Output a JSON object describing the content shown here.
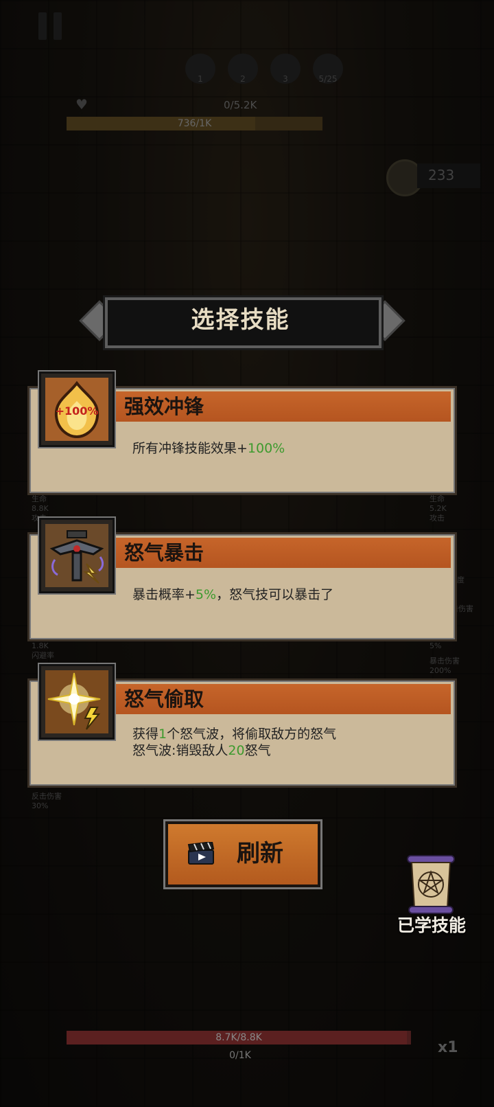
{
  "hud": {
    "stage_numbers": [
      "1",
      "2",
      "3",
      "5/25"
    ],
    "enemy_hp": "0/5.2K",
    "enemy_rage": "736/1K",
    "enemy_rage_fill": 0.736,
    "coins": "233",
    "left_stats": [
      "生命",
      "8.8K",
      "攻击",
      "1.8K",
      "闪避率",
      "反击伤害",
      "30%"
    ],
    "right_stats": [
      "生命",
      "5.2K",
      "攻击",
      "度",
      "暴击伤害",
      "5%",
      "暴击伤害",
      "200%"
    ]
  },
  "dialog": {
    "title": "选择技能"
  },
  "skills": [
    {
      "name": "强效冲锋",
      "icon": "flame-icon",
      "icon_text": "+100%",
      "desc_lines": [
        {
          "prefix": "所有冲锋技能效果+",
          "value": "100%",
          "suffix": ""
        }
      ]
    },
    {
      "name": "怒气暴击",
      "icon": "hammer-crit-icon",
      "desc_lines": [
        {
          "prefix": "暴击概率+",
          "value": "5%",
          "suffix": "，怒气技可以暴击了"
        }
      ]
    },
    {
      "name": "怒气偷取",
      "icon": "star-lightning-icon",
      "desc_lines": [
        {
          "prefix": "获得",
          "value": "1",
          "suffix": "个怒气波，将偷取敌方的怒气"
        },
        {
          "prefix": "怒气波:销毁敌人",
          "value": "20",
          "suffix": "怒气"
        }
      ]
    }
  ],
  "refresh": {
    "label": "刷新",
    "icon": "clapperboard-icon"
  },
  "learned": {
    "label": "已学技能",
    "icon": "scroll-icon"
  },
  "player": {
    "hp": "8.7K/8.8K",
    "hp_fill": 0.989,
    "rage": "0/1K",
    "speed": "x1"
  },
  "colors": {
    "accent_orange": "#c6652a",
    "card_parchment": "#cbb99a",
    "value_green": "#3d9a2e"
  }
}
